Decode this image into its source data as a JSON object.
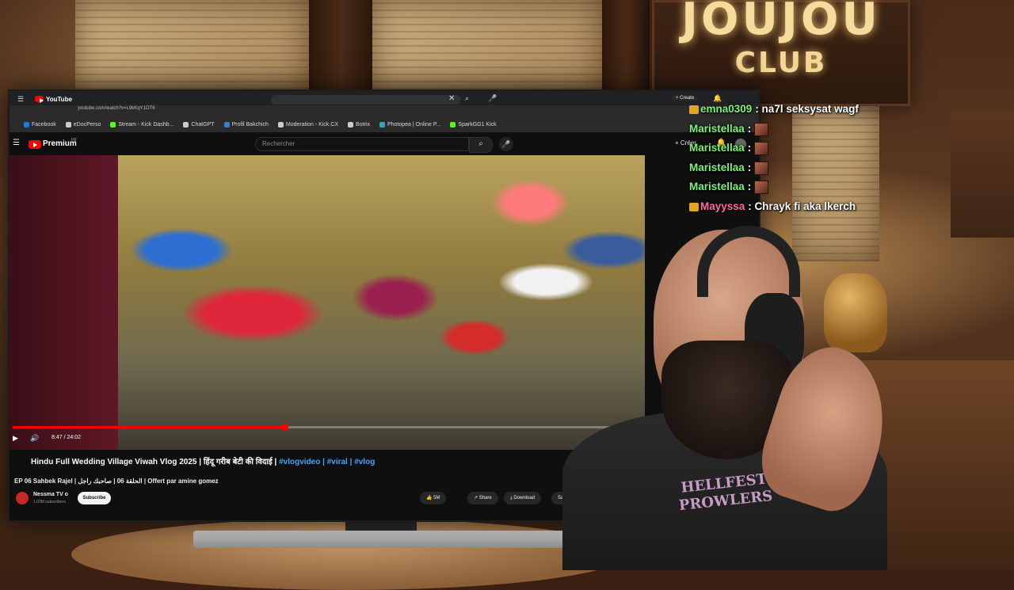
{
  "sign": {
    "line1": "JOUJOU",
    "line2": "CLUB"
  },
  "browser": {
    "tab_label": "YouTube",
    "url": "youtube.com/watch?v=L9kKqY1OT6",
    "bookmarks": [
      {
        "label": "Facebook",
        "color": "#1877f2"
      },
      {
        "label": "eDocPerso",
        "color": "#cccccc"
      },
      {
        "label": "Stream - Kick Dashb...",
        "color": "#53fc18"
      },
      {
        "label": "ChatGPT",
        "color": "#cccccc"
      },
      {
        "label": "Profil Bakchich",
        "color": "#3b7dd8"
      },
      {
        "label": "Moderation - Kick.CX",
        "color": "#cccccc"
      },
      {
        "label": "Botrix",
        "color": "#cccccc"
      },
      {
        "label": "Photopea | Online P...",
        "color": "#2fa8b6"
      },
      {
        "label": "SparkGG1 Kick",
        "color": "#53fc18"
      }
    ],
    "create_label": "Create"
  },
  "youtube": {
    "logo_label": "Premium",
    "logo_region": "FR",
    "search_placeholder": "Rechercher",
    "create_label": "Créer",
    "time_display": "8:47 / 24:02",
    "progress_fraction": 0.44,
    "video_title_main": "Hindu Full Wedding Village Viwah Vlog 2025 | हिंदू गरीब बेटी की विदाई | ",
    "video_title_tags": "#vlogvideo | #viral | #vlog",
    "subtitle_line": "EP 06 Sahbek Rajel | الحلقة 06 | صاحبك راجل | Offert par amine gomez",
    "channel_name": "Nessma TV o",
    "channel_subs": "1.03M subscribers",
    "subscribe_label": "Subscribe",
    "actions": {
      "like": "👍 5M",
      "share": "↗ Share",
      "download": "⤓ Download",
      "save": "Sa"
    }
  },
  "chat": {
    "messages": [
      {
        "user": "emna0309",
        "text": ": na7l seksysat wagf",
        "user_color": "green"
      },
      {
        "user": "Maristellaa",
        "text": ":",
        "emote": true,
        "user_color": "green"
      },
      {
        "user": "Maristellaa",
        "text": ":",
        "emote": true,
        "user_color": "green"
      },
      {
        "user": "Maristellaa",
        "text": ":",
        "emote": true,
        "user_color": "green"
      },
      {
        "user": "Maristellaa",
        "text": ":",
        "emote": true,
        "user_color": "green"
      },
      {
        "user": "Mayyssa",
        "text": ": Chrayk fi aka lkerch",
        "user_color": "pink"
      }
    ]
  },
  "shirt_print": {
    "line1": "HELLFEST",
    "line2": "PROWLERS"
  }
}
